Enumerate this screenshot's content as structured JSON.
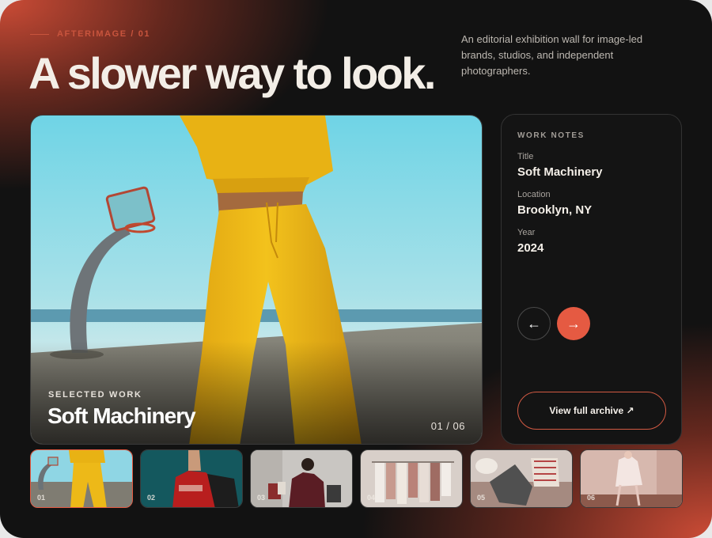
{
  "header": {
    "eyebrow": "AFTERIMAGE / 01",
    "headline": "A slower way to look.",
    "intro": "An editorial exhibition wall for image-led brands, studios, and independent photographers."
  },
  "hero": {
    "kicker": "SELECTED WORK",
    "title": "Soft Machinery",
    "counter": "01 / 06"
  },
  "notes": {
    "heading": "WORK NOTES",
    "fields": [
      {
        "label": "Title",
        "value": "Soft Machinery"
      },
      {
        "label": "Location",
        "value": "Brooklyn, NY"
      },
      {
        "label": "Year",
        "value": "2024"
      }
    ],
    "prev_icon": "arrow-left-icon",
    "next_icon": "arrow-right-icon",
    "prev_glyph": "←",
    "next_glyph": "→",
    "archive_label": "View full archive ↗"
  },
  "thumbnails": [
    {
      "num": "01",
      "active": true
    },
    {
      "num": "02",
      "active": false
    },
    {
      "num": "03",
      "active": false
    },
    {
      "num": "04",
      "active": false
    },
    {
      "num": "05",
      "active": false
    },
    {
      "num": "06",
      "active": false
    }
  ],
  "colors": {
    "accent": "#e55a42",
    "background": "#121212",
    "text": "#f3eee7"
  }
}
